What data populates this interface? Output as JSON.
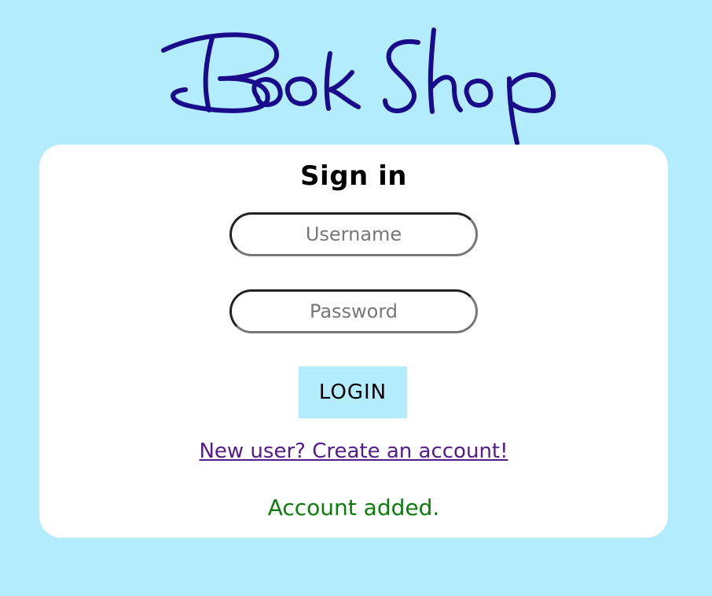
{
  "logo": {
    "text": "BookShop",
    "color": "#1a0a8c"
  },
  "signin": {
    "title": "Sign in",
    "username_placeholder": "Username",
    "password_placeholder": "Password",
    "login_label": "LOGIN",
    "signup_link": "New user? Create an account!",
    "status_message": "Account added."
  },
  "colors": {
    "background": "#b3ecfc",
    "card": "#ffffff",
    "button": "#b3ecfc",
    "link": "#551a8b",
    "success": "#0b7d0b"
  }
}
